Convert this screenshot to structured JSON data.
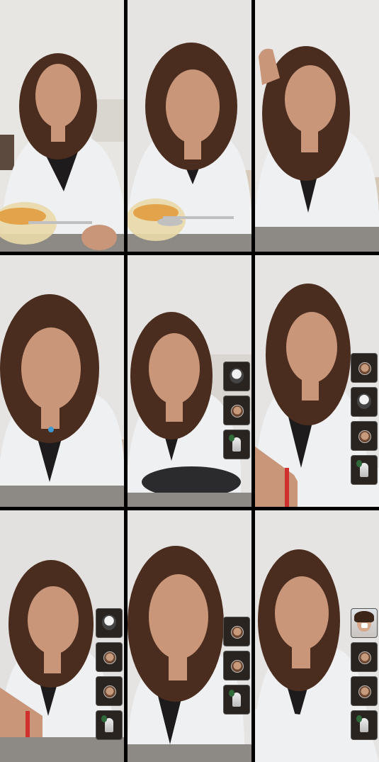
{
  "grid": {
    "rows": 3,
    "cols": 3,
    "background": "#000000"
  },
  "tiles": [
    {
      "id": "r1c1",
      "scene": "eating",
      "sidebar": []
    },
    {
      "id": "r1c2",
      "scene": "eating",
      "sidebar": []
    },
    {
      "id": "r1c3",
      "scene": "hand-on-head",
      "sidebar": []
    },
    {
      "id": "r2c1",
      "scene": "close",
      "sidebar": []
    },
    {
      "id": "r2c2",
      "scene": "talking",
      "sidebar": [
        "selfie",
        "avatar",
        "figure"
      ]
    },
    {
      "id": "r2c3",
      "scene": "talking-arm",
      "sidebar": [
        "avatar",
        "selfie",
        "avatar",
        "figure"
      ]
    },
    {
      "id": "r3c1",
      "scene": "talking-arm",
      "sidebar": [
        "selfie",
        "avatar",
        "avatar",
        "figure"
      ]
    },
    {
      "id": "r3c2",
      "scene": "close",
      "sidebar": [
        "avatar",
        "avatar",
        "figure"
      ]
    },
    {
      "id": "r3c3",
      "scene": "talking",
      "sidebar": [
        "photo",
        "avatar",
        "avatar",
        "figure"
      ]
    }
  ],
  "colors": {
    "wall": "#e6e4e2",
    "shirt": "#eef0f2",
    "hair": "#4a2d1e",
    "skin": "#c9967a",
    "counter": "#8d8a86"
  }
}
